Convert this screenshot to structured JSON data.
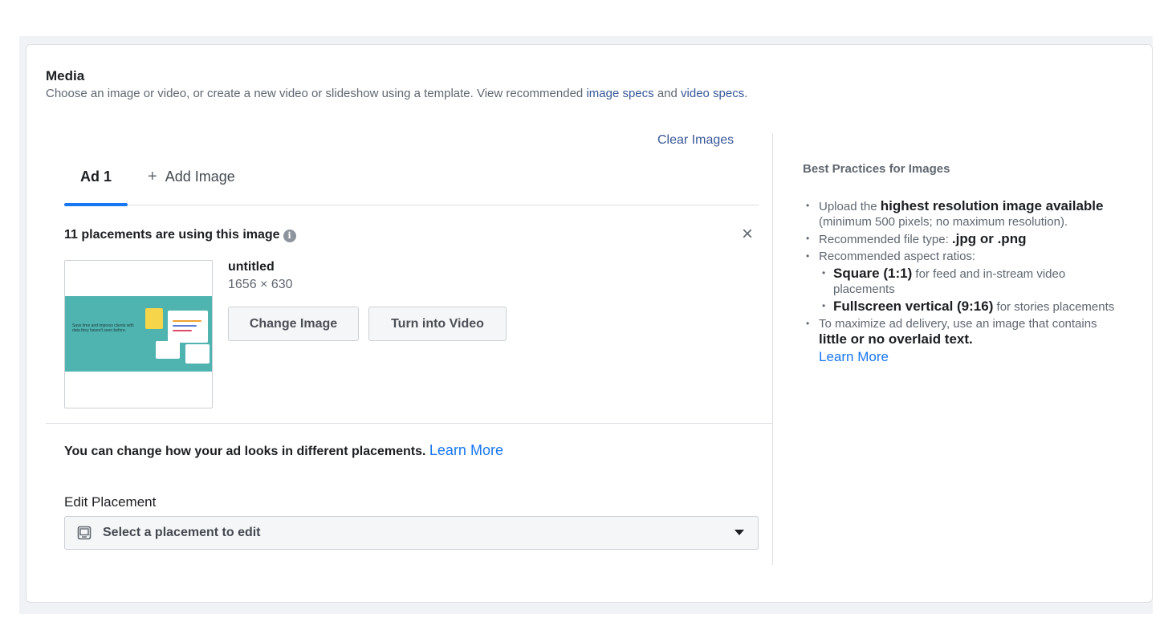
{
  "media": {
    "title": "Media",
    "desc_prefix": "Choose an image or video, or create a new video or slideshow using a template. View recommended ",
    "image_specs_link": "image specs",
    "desc_and": " and ",
    "video_specs_link": "video specs",
    "desc_suffix": "."
  },
  "clear_images": "Clear Images",
  "tabs": {
    "ad1": "Ad 1",
    "add_plus": "+",
    "add_image": "Add Image"
  },
  "placements_text": "11 placements are using this image",
  "info_glyph": "i",
  "close_glyph": "×",
  "image": {
    "name": "untitled",
    "size": "1656 × 630",
    "thumb_text": "Save time and impress clients with data they haven't seen before."
  },
  "buttons": {
    "change_image": "Change Image",
    "turn_into_video": "Turn into Video"
  },
  "change_note": {
    "text": "You can change how your ad looks in different placements.",
    "link": "Learn More"
  },
  "edit_placement": {
    "label": "Edit Placement",
    "select_value": "Select a placement to edit"
  },
  "best_practices": {
    "title": "Best Practices for Images",
    "item1_a": "Upload the ",
    "item1_bold": "highest resolution image available",
    "item1_b": " (minimum 500 pixels; no maximum resolution).",
    "item2_a": "Recommended file type: ",
    "item2_bold": ".jpg or .png",
    "item3": "Recommended aspect ratios:",
    "sub1_bold": "Square (1:1)",
    "sub1_rest": " for feed and in-stream video placements",
    "sub2_bold": "Fullscreen vertical (9:16)",
    "sub2_rest": " for stories placements",
    "item4_a": "To maximize ad delivery, use an image that contains ",
    "item4_bold": "little or no overlaid text.",
    "learn_more": "Learn More"
  },
  "colors": {
    "accent": "#1877f2",
    "link": "#385898",
    "thumb_teal": "#4fb3b0"
  }
}
